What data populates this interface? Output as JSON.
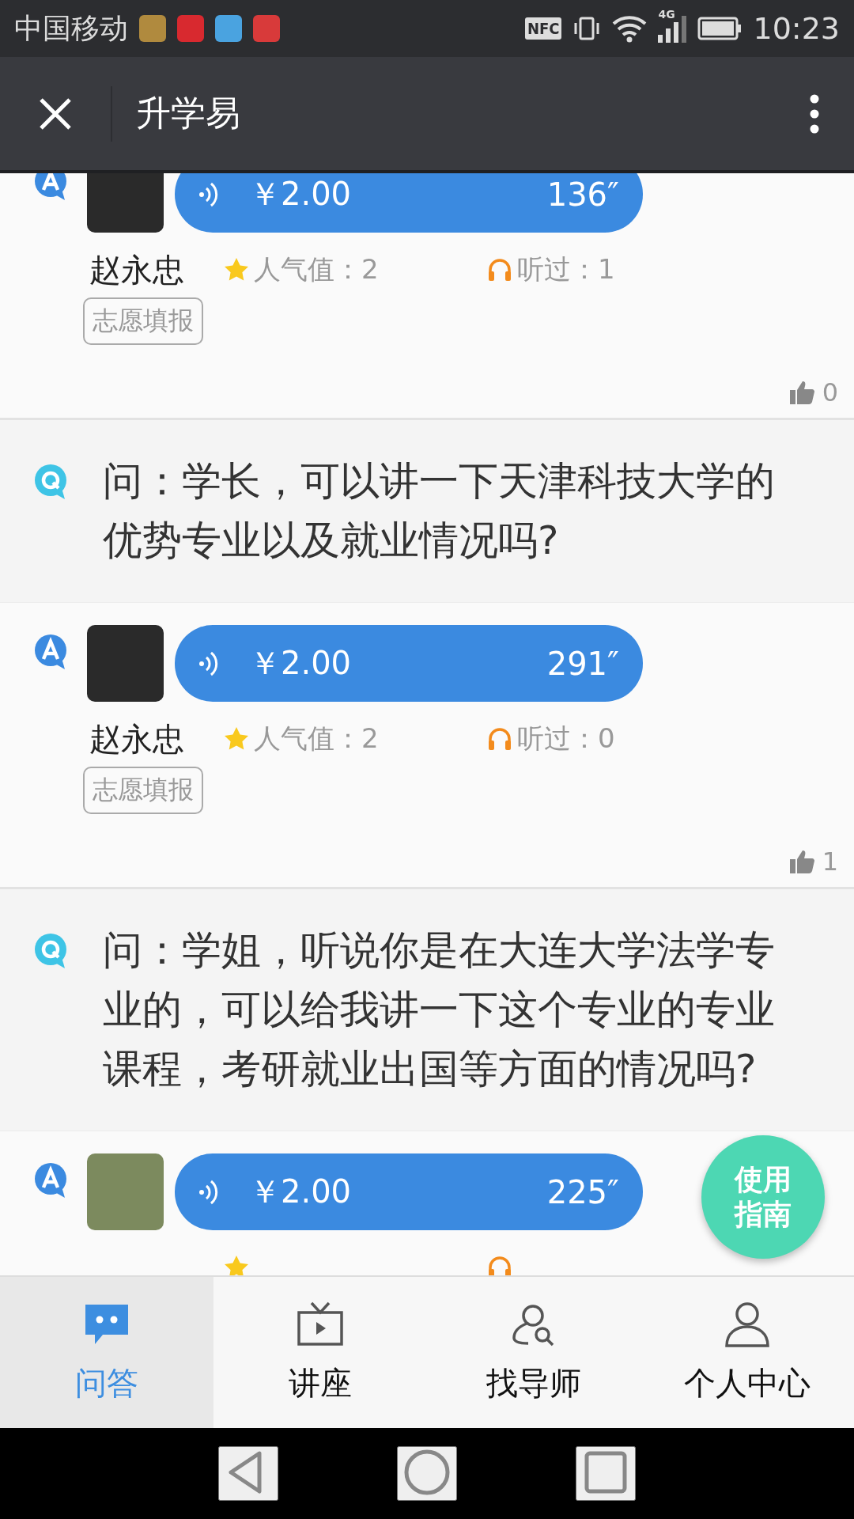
{
  "status_bar": {
    "carrier": "中国移动",
    "nfc": "NFC",
    "network": "4G",
    "time": "10:23"
  },
  "app_bar": {
    "title": "升学易"
  },
  "feed": [
    {
      "kind": "answer",
      "price": "￥2.00",
      "duration": "136″",
      "name": "赵永忠",
      "popularity": "人气值：2",
      "listened": "听过：1",
      "tag": "志愿填报",
      "likes": "0"
    },
    {
      "kind": "question",
      "text": "问：学长，可以讲一下天津科技大学的优势专业以及就业情况吗?"
    },
    {
      "kind": "answer",
      "price": "￥2.00",
      "duration": "291″",
      "name": "赵永忠",
      "popularity": "人气值：2",
      "listened": "听过：0",
      "tag": "志愿填报",
      "likes": "1"
    },
    {
      "kind": "question",
      "text": "问：学姐，听说你是在大连大学法学专业的，可以给我讲一下这个专业的专业课程，考研就业出国等方面的情况吗?"
    },
    {
      "kind": "answer",
      "price": "￥2.00",
      "duration": "225″"
    }
  ],
  "fab": {
    "label": "使用指南"
  },
  "tabs": [
    {
      "label": "问答",
      "selected": true
    },
    {
      "label": "讲座",
      "selected": false
    },
    {
      "label": "找导师",
      "selected": false
    },
    {
      "label": "个人中心",
      "selected": false
    }
  ]
}
